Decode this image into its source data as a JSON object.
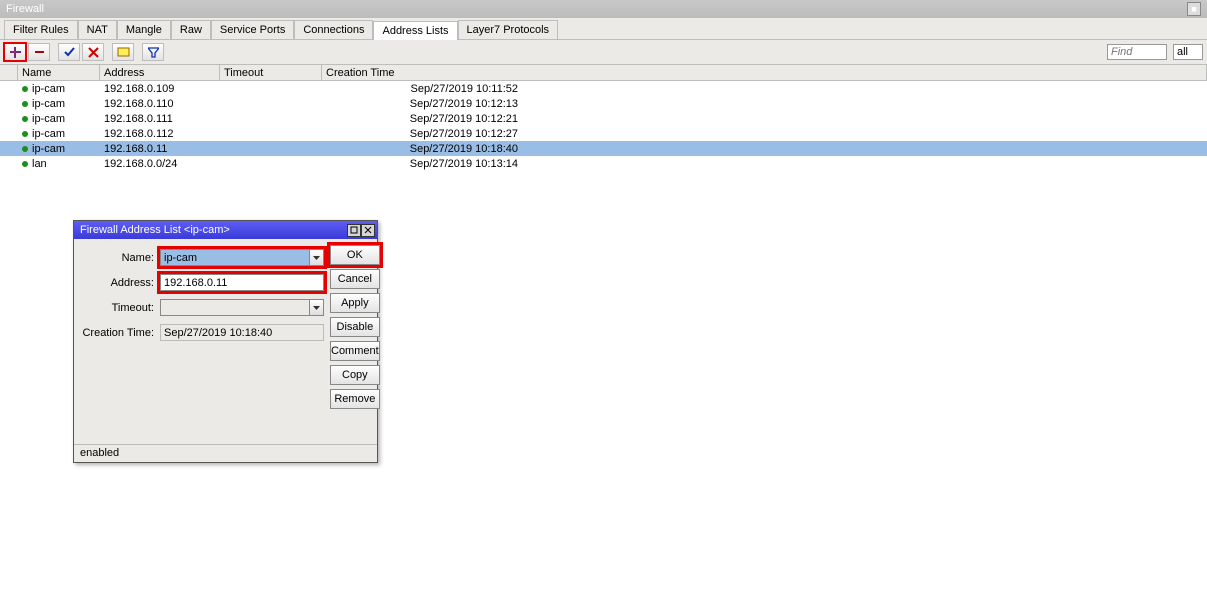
{
  "window": {
    "title": "Firewall"
  },
  "tabs": [
    {
      "label": "Filter Rules"
    },
    {
      "label": "NAT"
    },
    {
      "label": "Mangle"
    },
    {
      "label": "Raw"
    },
    {
      "label": "Service Ports"
    },
    {
      "label": "Connections"
    },
    {
      "label": "Address Lists"
    },
    {
      "label": "Layer7 Protocols"
    }
  ],
  "active_tab": 6,
  "toolbar": {
    "find_placeholder": "Find",
    "filter_value": "all"
  },
  "columns": {
    "name": "Name",
    "address": "Address",
    "timeout": "Timeout",
    "creation_time": "Creation Time"
  },
  "rows": [
    {
      "name": "ip-cam",
      "address": "192.168.0.109",
      "timeout": "",
      "ctime": "Sep/27/2019 10:11:52",
      "selected": false
    },
    {
      "name": "ip-cam",
      "address": "192.168.0.110",
      "timeout": "",
      "ctime": "Sep/27/2019 10:12:13",
      "selected": false
    },
    {
      "name": "ip-cam",
      "address": "192.168.0.111",
      "timeout": "",
      "ctime": "Sep/27/2019 10:12:21",
      "selected": false
    },
    {
      "name": "ip-cam",
      "address": "192.168.0.112",
      "timeout": "",
      "ctime": "Sep/27/2019 10:12:27",
      "selected": false
    },
    {
      "name": "ip-cam",
      "address": "192.168.0.11",
      "timeout": "",
      "ctime": "Sep/27/2019 10:18:40",
      "selected": true
    },
    {
      "name": "lan",
      "address": "192.168.0.0/24",
      "timeout": "",
      "ctime": "Sep/27/2019 10:13:14",
      "selected": false
    }
  ],
  "dialog": {
    "title": "Firewall Address List <ip-cam>",
    "labels": {
      "name": "Name:",
      "address": "Address:",
      "timeout": "Timeout:",
      "creation_time": "Creation Time:"
    },
    "values": {
      "name": "ip-cam",
      "address": "192.168.0.11",
      "timeout": "",
      "creation_time": "Sep/27/2019 10:18:40"
    },
    "buttons": {
      "ok": "OK",
      "cancel": "Cancel",
      "apply": "Apply",
      "disable": "Disable",
      "comment": "Comment",
      "copy": "Copy",
      "remove": "Remove"
    },
    "status": "enabled"
  }
}
